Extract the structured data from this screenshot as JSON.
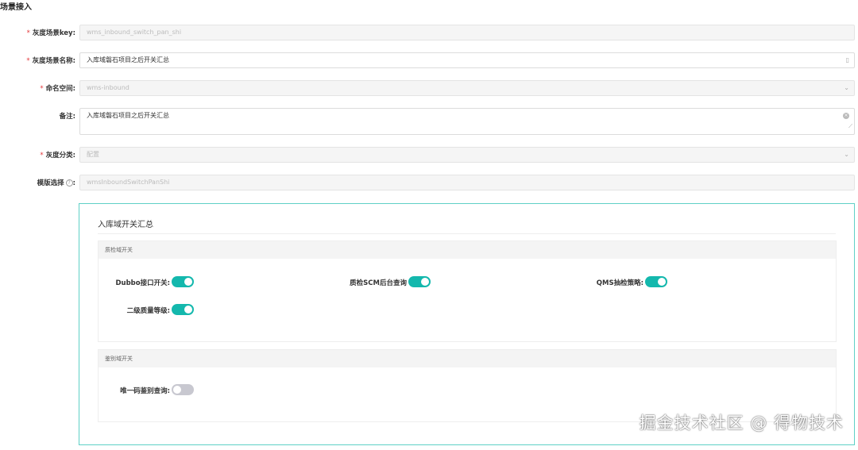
{
  "page": {
    "title": "场景接入"
  },
  "form": {
    "scene_key": {
      "label": "灰度场景key:",
      "value": "wms_inbound_switch_pan_shi",
      "required": true
    },
    "scene_name": {
      "label": "灰度场景名称:",
      "value": "入库域磐石项目之后开关汇总",
      "required": true
    },
    "namespace": {
      "label": "命名空间:",
      "value": "wms-inbound",
      "required": true
    },
    "remark": {
      "label": "备注:",
      "value": "入库域磐石项目之后开关汇总",
      "required": false
    },
    "category": {
      "label": "灰度分类:",
      "value": "配置",
      "required": true
    },
    "template": {
      "label": "模版选择",
      "help_icon": "?",
      "value": "wmsInboundSwitchPanShi",
      "required": false
    }
  },
  "panel": {
    "title": "入库域开关汇总",
    "sections": [
      {
        "title": "质检域开关",
        "switches": [
          {
            "label": "Dubbo接口开关:",
            "on": true
          },
          {
            "label": "质检SCM后台查询",
            "on": true
          },
          {
            "label": "QMS抽检策略:",
            "on": true
          },
          {
            "label": "二级质量等级:",
            "on": true
          }
        ]
      },
      {
        "title": "鉴别域开关",
        "switches": [
          {
            "label": "唯一码鉴别查询:",
            "on": false
          }
        ]
      }
    ]
  },
  "watermark": "掘金技术社区 @ 得物技术",
  "colors": {
    "accent": "#14b8ad",
    "required": "#e4393c",
    "panel_border": "#5fd0c6",
    "toggle_off": "#c8c8d0"
  },
  "icons": {
    "select_arrow": "chevron-down-icon",
    "input_suffix": "clear-icon",
    "resize": "resize-handle-icon"
  }
}
